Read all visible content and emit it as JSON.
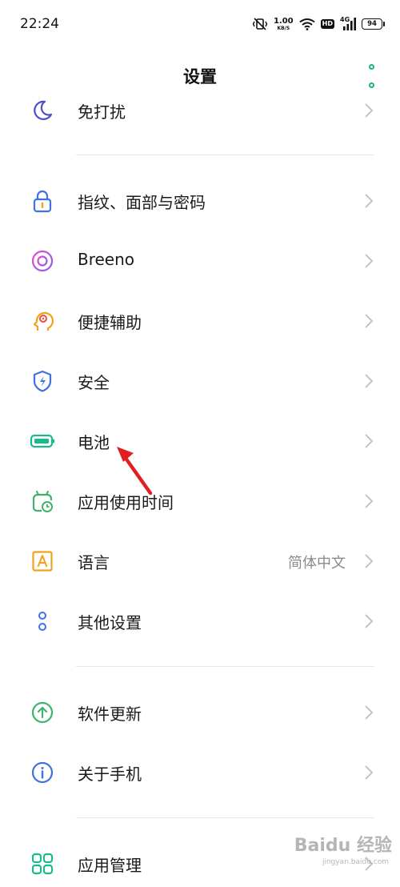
{
  "status_bar": {
    "time": "22:24",
    "speed_value": "1.00",
    "speed_unit": "KB/S",
    "hd": "HD",
    "network": "4G",
    "battery": "94"
  },
  "header": {
    "title": "设置"
  },
  "items": [
    {
      "label": "免打扰",
      "icon": "moon-icon"
    },
    {
      "label": "指纹、面部与密码",
      "icon": "lock-icon"
    },
    {
      "label": "Breeno",
      "icon": "breeno-icon"
    },
    {
      "label": "便捷辅助",
      "icon": "assist-icon"
    },
    {
      "label": "安全",
      "icon": "shield-icon"
    },
    {
      "label": "电池",
      "icon": "battery-icon"
    },
    {
      "label": "应用使用时间",
      "icon": "app-timer-icon"
    },
    {
      "label": "语言",
      "icon": "language-icon",
      "value": "简体中文"
    },
    {
      "label": "其他设置",
      "icon": "more-settings-icon"
    },
    {
      "label": "软件更新",
      "icon": "update-icon"
    },
    {
      "label": "关于手机",
      "icon": "info-icon"
    },
    {
      "label": "应用管理",
      "icon": "app-management-icon"
    }
  ],
  "colors": {
    "accent_green": "#1fb46f",
    "annotation_red": "#e02020"
  },
  "watermark": {
    "text": "Baidu 经验",
    "sub": "jingyan.baidu.com"
  }
}
